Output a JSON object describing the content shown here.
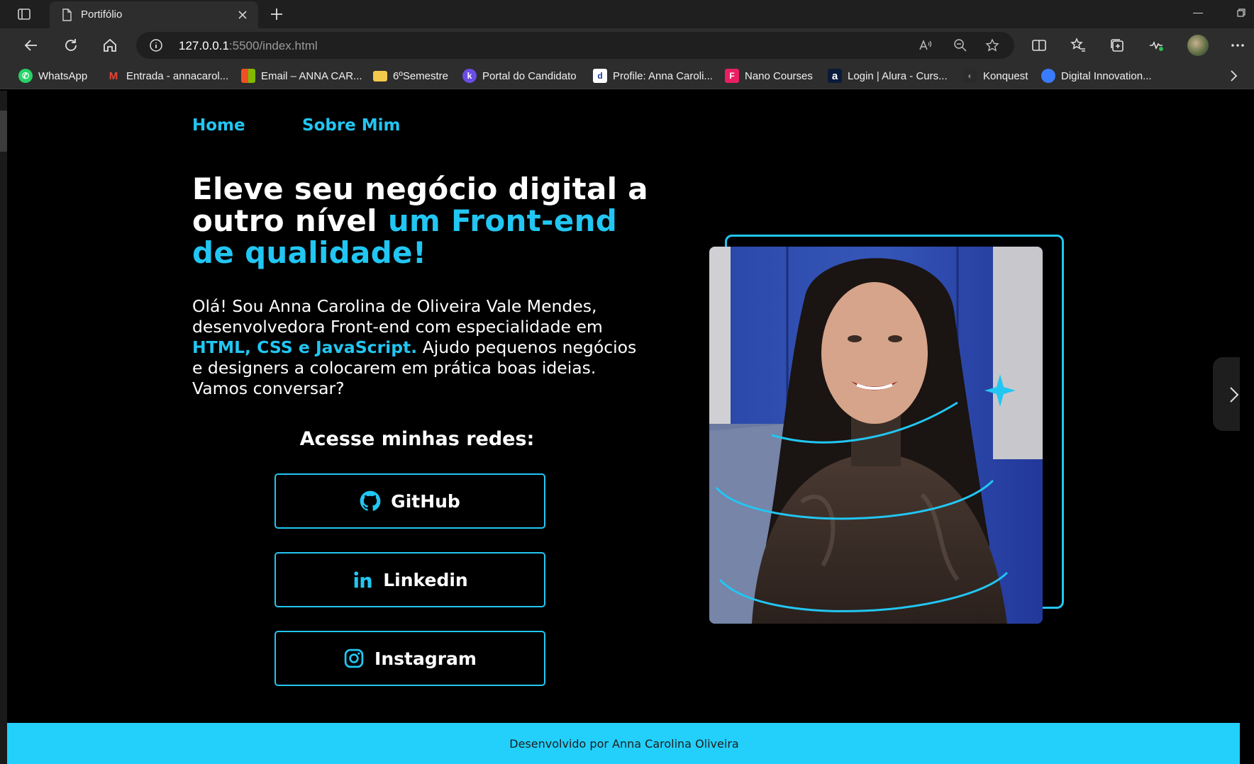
{
  "browser": {
    "tab_title": "Portifólio",
    "url_host": "127.0.0.1",
    "url_rest": ":5500/index.html",
    "bookmarks": [
      {
        "label": "WhatsApp",
        "icon": "whatsapp-icon",
        "color": "#25d366"
      },
      {
        "label": "Entrada - annacarol...",
        "icon": "gmail-icon",
        "color": "#ea4335"
      },
      {
        "label": "Email – ANNA CAR...",
        "icon": "microsoft-icon",
        "color": "#f25022"
      },
      {
        "label": "6ºSemestre",
        "icon": "folder-icon",
        "color": "#f2c94c"
      },
      {
        "label": "Portal do Candidato",
        "icon": "portal-icon",
        "color": "#6b4de6"
      },
      {
        "label": "Profile: Anna Caroli...",
        "icon": "dio-icon",
        "color": "#ffffff"
      },
      {
        "label": "Nano Courses",
        "icon": "nano-courses-icon",
        "color": "#e91e63"
      },
      {
        "label": "Login | Alura - Curs...",
        "icon": "alura-icon",
        "color": "#0b1a3a"
      },
      {
        "label": "Konquest",
        "icon": "konquest-icon",
        "color": "#333333"
      },
      {
        "label": "Digital Innovation...",
        "icon": "dio-drop-icon",
        "color": "#3a7bfd"
      }
    ]
  },
  "page": {
    "nav": {
      "home": "Home",
      "about": "Sobre Mim"
    },
    "headline": {
      "part1": "Eleve seu negócio digital a outro nível ",
      "highlight": "um Front-end de qualidade!"
    },
    "intro": {
      "part1": "Olá! Sou Anna Carolina de Oliveira Vale Mendes, desenvolvedora Front-end com especialidade em ",
      "highlight": "HTML, CSS e JavaScript.",
      "part2": " Ajudo pequenos negócios e designers a colocarem em prática boas ideias. Vamos conversar?"
    },
    "networks_title": "Acesse minhas redes:",
    "buttons": {
      "github": "GitHub",
      "linkedin": "Linkedin",
      "instagram": "Instagram"
    },
    "footer": "Desenvolvido por Anna Carolina Oliveira",
    "accent_color": "#22c6f2"
  }
}
